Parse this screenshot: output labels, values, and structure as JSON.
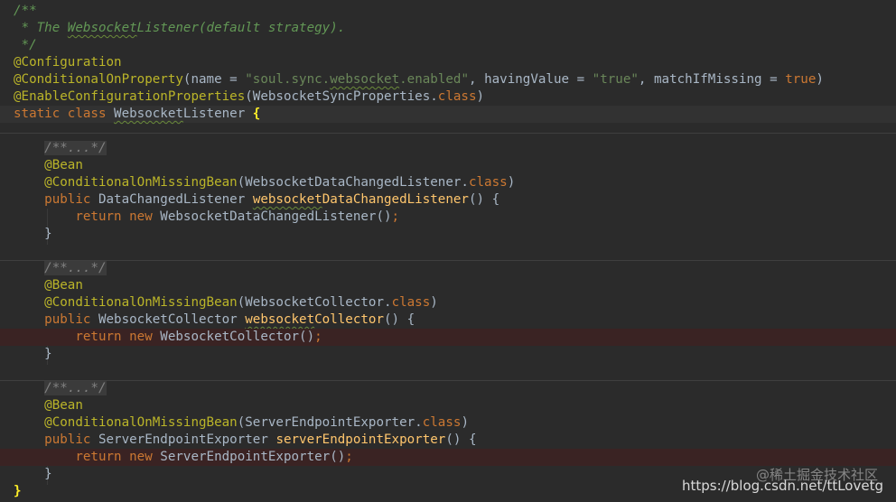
{
  "editor": {
    "lines": [
      {
        "bg": "",
        "tokens": [
          {
            "t": "/**",
            "c": "comment"
          }
        ]
      },
      {
        "bg": "",
        "tokens": [
          {
            "t": " * The ",
            "c": "comment"
          },
          {
            "t": "Websocket",
            "c": "comment",
            "sq": true
          },
          {
            "t": "Listener(default strategy).",
            "c": "comment"
          }
        ]
      },
      {
        "bg": "",
        "tokens": [
          {
            "t": " */",
            "c": "comment"
          }
        ]
      },
      {
        "bg": "",
        "tokens": [
          {
            "t": "@Configuration",
            "c": "anno"
          }
        ]
      },
      {
        "bg": "",
        "tokens": [
          {
            "t": "@ConditionalOnProperty",
            "c": "anno"
          },
          {
            "t": "(name = ",
            "c": "plain"
          },
          {
            "t": "\"soul.sync.",
            "c": "str"
          },
          {
            "t": "websocket",
            "c": "str",
            "sq": true
          },
          {
            "t": ".enabled\"",
            "c": "str"
          },
          {
            "t": ", havingValue = ",
            "c": "plain"
          },
          {
            "t": "\"true\"",
            "c": "str"
          },
          {
            "t": ", matchIfMissing = ",
            "c": "plain"
          },
          {
            "t": "true",
            "c": "kw"
          },
          {
            "t": ")",
            "c": "plain"
          }
        ]
      },
      {
        "bg": "",
        "tokens": [
          {
            "t": "@EnableConfigurationProperties",
            "c": "anno"
          },
          {
            "t": "(WebsocketSyncProperties.",
            "c": "plain"
          },
          {
            "t": "class",
            "c": "kw"
          },
          {
            "t": ")",
            "c": "plain"
          }
        ]
      },
      {
        "bg": "current",
        "tokens": [
          {
            "t": "static class ",
            "c": "kw"
          },
          {
            "t": "Websocket",
            "c": "plain",
            "sq": true
          },
          {
            "t": "Listener ",
            "c": "plain"
          },
          {
            "t": "{",
            "c": "brace-match"
          }
        ]
      },
      {
        "bg": "",
        "tokens": []
      },
      {
        "bg": "",
        "tokens": [
          {
            "t": "    ",
            "c": "plain"
          },
          {
            "t": "/**...*/",
            "c": "fold"
          }
        ]
      },
      {
        "bg": "",
        "tokens": [
          {
            "t": "    @Bean",
            "c": "anno"
          }
        ]
      },
      {
        "bg": "",
        "tokens": [
          {
            "t": "    @ConditionalOnMissingBean",
            "c": "anno"
          },
          {
            "t": "(WebsocketDataChangedListener.",
            "c": "plain"
          },
          {
            "t": "class",
            "c": "kw"
          },
          {
            "t": ")",
            "c": "plain"
          }
        ]
      },
      {
        "bg": "",
        "tokens": [
          {
            "t": "    public ",
            "c": "kw"
          },
          {
            "t": "DataChangedListener ",
            "c": "plain"
          },
          {
            "t": "websocket",
            "c": "fn",
            "sq": true
          },
          {
            "t": "DataChangedListener",
            "c": "fn"
          },
          {
            "t": "() {",
            "c": "plain"
          }
        ]
      },
      {
        "bg": "",
        "tokens": [
          {
            "t": "        return new ",
            "c": "kw"
          },
          {
            "t": "WebsocketDataChangedListener()",
            "c": "plain"
          },
          {
            "t": ";",
            "c": "kw"
          }
        ]
      },
      {
        "bg": "",
        "tokens": [
          {
            "t": "    }",
            "c": "plain"
          }
        ]
      },
      {
        "bg": "",
        "tokens": []
      },
      {
        "bg": "",
        "tokens": [
          {
            "t": "    ",
            "c": "plain"
          },
          {
            "t": "/**...*/",
            "c": "fold"
          }
        ]
      },
      {
        "bg": "",
        "tokens": [
          {
            "t": "    @Bean",
            "c": "anno"
          }
        ]
      },
      {
        "bg": "",
        "tokens": [
          {
            "t": "    @ConditionalOnMissingBean",
            "c": "anno"
          },
          {
            "t": "(WebsocketCollector.",
            "c": "plain"
          },
          {
            "t": "class",
            "c": "kw"
          },
          {
            "t": ")",
            "c": "plain"
          }
        ]
      },
      {
        "bg": "",
        "tokens": [
          {
            "t": "    public ",
            "c": "kw"
          },
          {
            "t": "WebsocketCollector ",
            "c": "plain"
          },
          {
            "t": "websocket",
            "c": "fn",
            "sq": true
          },
          {
            "t": "Collector",
            "c": "fn"
          },
          {
            "t": "() {",
            "c": "plain"
          }
        ]
      },
      {
        "bg": "error",
        "tokens": [
          {
            "t": "        return new ",
            "c": "kw"
          },
          {
            "t": "WebsocketCollector()",
            "c": "plain"
          },
          {
            "t": ";",
            "c": "kw"
          }
        ]
      },
      {
        "bg": "",
        "tokens": [
          {
            "t": "    }",
            "c": "plain"
          }
        ]
      },
      {
        "bg": "",
        "tokens": []
      },
      {
        "bg": "",
        "tokens": [
          {
            "t": "    ",
            "c": "plain"
          },
          {
            "t": "/**...*/",
            "c": "fold"
          }
        ]
      },
      {
        "bg": "",
        "tokens": [
          {
            "t": "    @Bean",
            "c": "anno"
          }
        ]
      },
      {
        "bg": "",
        "tokens": [
          {
            "t": "    @ConditionalOnMissingBean",
            "c": "anno"
          },
          {
            "t": "(ServerEndpointExporter.",
            "c": "plain"
          },
          {
            "t": "class",
            "c": "kw"
          },
          {
            "t": ")",
            "c": "plain"
          }
        ]
      },
      {
        "bg": "",
        "tokens": [
          {
            "t": "    public ",
            "c": "kw"
          },
          {
            "t": "ServerEndpointExporter ",
            "c": "plain"
          },
          {
            "t": "serverEndpointExporter",
            "c": "fn"
          },
          {
            "t": "() {",
            "c": "plain"
          }
        ]
      },
      {
        "bg": "error",
        "tokens": [
          {
            "t": "        return new ",
            "c": "kw"
          },
          {
            "t": "ServerEndpointExporter()",
            "c": "plain"
          },
          {
            "t": ";",
            "c": "kw"
          }
        ]
      },
      {
        "bg": "",
        "tokens": [
          {
            "t": "    }",
            "c": "plain"
          }
        ]
      },
      {
        "bg": "",
        "tokens": [
          {
            "t": "}",
            "c": "brace-match"
          }
        ]
      }
    ]
  },
  "watermark": {
    "line1": "@稀土掘金技术社区",
    "line2": "https://blog.csdn.net/ttLovetg"
  },
  "colors": {
    "background": "#2b2b2b",
    "comment": "#629755",
    "annotation": "#bbb529",
    "keyword": "#cc7832",
    "string": "#6a8759",
    "method": "#ffc66d",
    "plain": "#a9b7c6"
  }
}
